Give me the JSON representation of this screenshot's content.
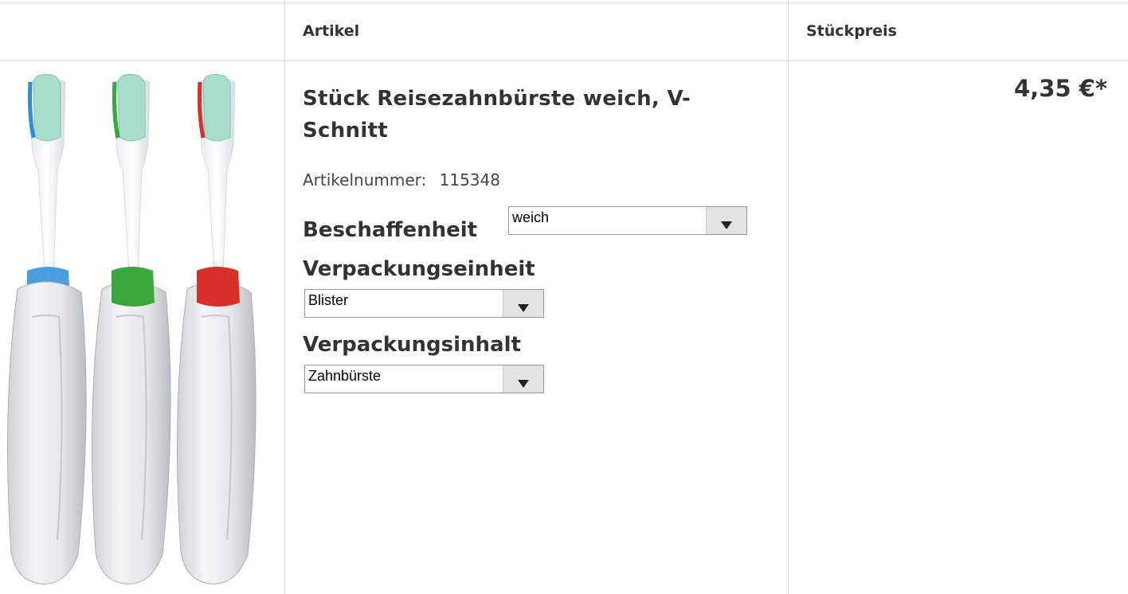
{
  "header": {
    "col_article": "Artikel",
    "col_unit_price": "Stückpreis"
  },
  "product": {
    "image_name": "travel-toothbrushes",
    "title": "Stück Reisezahnbürste weich, V-Schnitt",
    "article_number_label": "Artikelnummer:",
    "article_number": "115348",
    "price": "4,35 €*",
    "options": {
      "beschaffenheit": {
        "label": "Beschaffenheit",
        "value": "weich"
      },
      "verpackungseinheit": {
        "label": "Verpackungseinheit",
        "value": "Blister"
      },
      "verpackungsinhalt": {
        "label": "Verpackungsinhalt",
        "value": "Zahnbürste"
      }
    }
  },
  "colors": {
    "brush_accents": [
      "#2a8fd8",
      "#3aa83a",
      "#d9302a"
    ],
    "bristles": "#9fd6c6"
  }
}
